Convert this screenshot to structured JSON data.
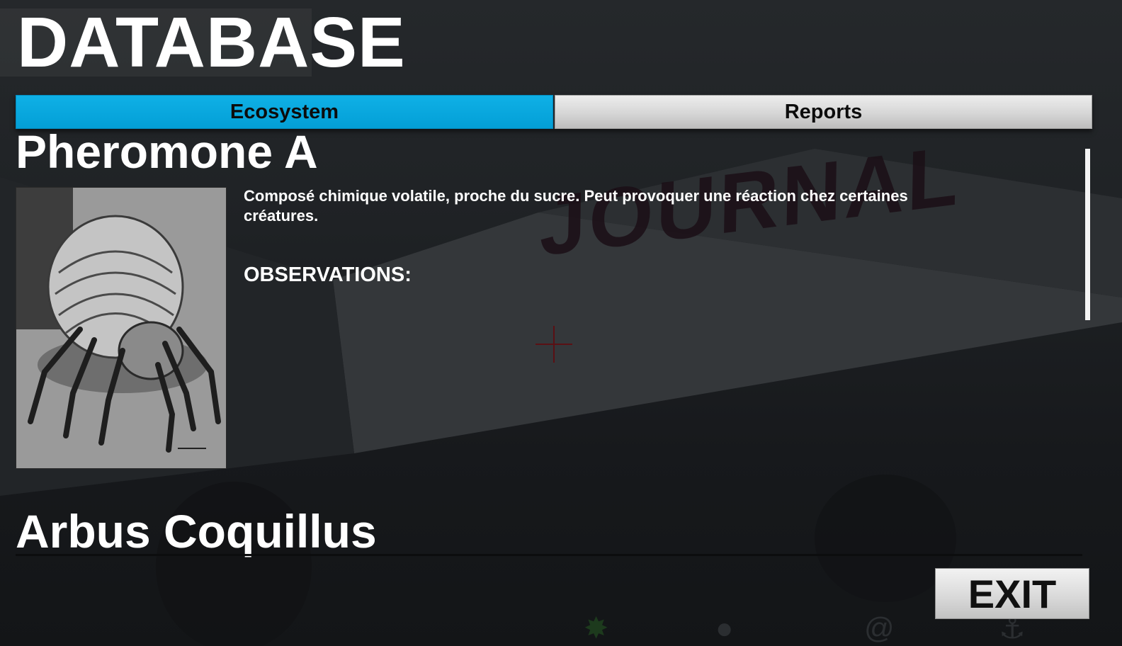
{
  "header": {
    "title": "DATABASE"
  },
  "tabs": [
    {
      "label": "Ecosystem",
      "active": true
    },
    {
      "label": "Reports",
      "active": false
    }
  ],
  "entries": [
    {
      "title": "Pheromone A",
      "description": "Composé chimique volatile, proche du sucre. Peut provoquer une réaction chez certaines créatures.",
      "observations_label": "OBSERVATIONS:",
      "image_subject": "dust mite micrograph"
    },
    {
      "title": "Arbus Coquillus"
    }
  ],
  "scene": {
    "journal_sign": "JOURNAL"
  },
  "footer": {
    "exit_label": "EXIT"
  },
  "colors": {
    "tab_active": "#039fd6",
    "tab_inactive": "#d6d6d6",
    "text": "#ffffff",
    "background": "#1f2225",
    "crosshair": "#5a1014"
  }
}
